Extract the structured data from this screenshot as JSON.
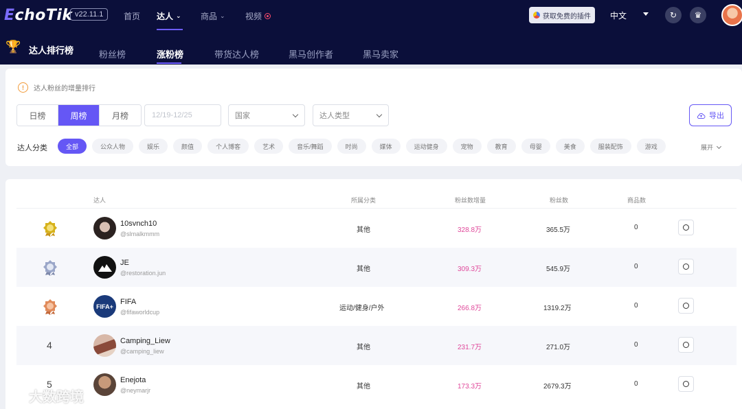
{
  "header": {
    "logo_prefix": "E",
    "logo_rest": "choTik",
    "version": "v22.11.1",
    "nav": [
      {
        "label": "首页"
      },
      {
        "label": "达人"
      },
      {
        "label": "商品"
      },
      {
        "label": "视频"
      }
    ],
    "plugin_button": "获取免费的插件",
    "language": "中文"
  },
  "subnav": {
    "title": "达人排行榜",
    "tabs": [
      "粉丝榜",
      "涨粉榜",
      "带货达人榜",
      "黑马创作者",
      "黑马卖家"
    ],
    "active_tab": "涨粉榜"
  },
  "filters": {
    "hint": "达人粉丝的增量排行",
    "periods": [
      "日榜",
      "周榜",
      "月榜"
    ],
    "active_period": "周榜",
    "date_range": "12/19-12/25",
    "country_placeholder": "国家",
    "type_placeholder": "达人类型",
    "export_label": "导出",
    "category_label": "达人分类",
    "categories": [
      "全部",
      "公众人物",
      "娱乐",
      "颜值",
      "个人博客",
      "艺术",
      "音乐/舞蹈",
      "时尚",
      "媒体",
      "运动健身",
      "宠物",
      "教育",
      "母婴",
      "美食",
      "服装配饰",
      "游戏"
    ],
    "expand_label": "展开"
  },
  "table": {
    "columns": [
      "达人",
      "所属分类",
      "粉丝数增量",
      "粉丝数",
      "商品数"
    ],
    "rows": [
      {
        "rank": "1",
        "name": "10svnch10",
        "handle": "@slmalkmmm",
        "category": "其他",
        "growth": "328.8万",
        "followers": "365.5万",
        "products": "0"
      },
      {
        "rank": "2",
        "name": "JE",
        "handle": "@restoration.jun",
        "category": "其他",
        "growth": "309.3万",
        "followers": "545.9万",
        "products": "0"
      },
      {
        "rank": "3",
        "name": "FIFA",
        "handle": "@fifaworldcup",
        "category": "运动/健身/户外",
        "growth": "266.8万",
        "followers": "1319.2万",
        "products": "0"
      },
      {
        "rank": "4",
        "name": "Camping_Liew",
        "handle": "@camping_liew",
        "category": "其他",
        "growth": "231.7万",
        "followers": "271.0万",
        "products": "0"
      },
      {
        "rank": "5",
        "name": "Enejota",
        "handle": "@neymarjr",
        "category": "其他",
        "growth": "173.3万",
        "followers": "2679.3万",
        "products": "0"
      }
    ]
  },
  "avatar_labels": {
    "fifa": "FIFA+"
  },
  "watermark": "大数跨境",
  "colors": {
    "accent": "#6557f5",
    "growth": "#e0489a",
    "navbar": "#0b0f3a",
    "gold": "#d6b21c",
    "silver": "#9aa6c8",
    "bronze": "#e08a5a"
  }
}
